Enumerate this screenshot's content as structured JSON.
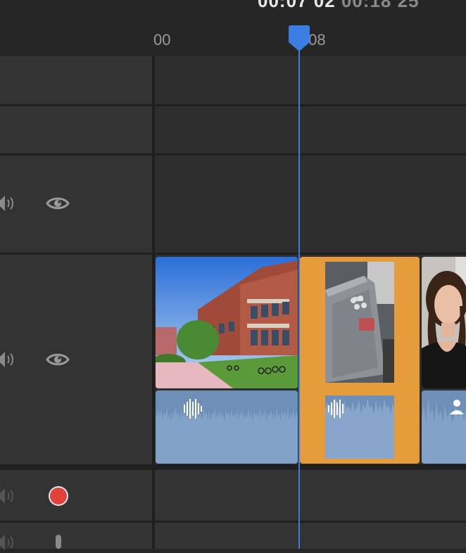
{
  "timecode": {
    "current": "00:07",
    "current_frames": "02",
    "total": "00:18",
    "total_frames": "25"
  },
  "ruler": {
    "label_left": "00",
    "label_right": ":08"
  },
  "tracks": [
    {
      "name": "title-track"
    },
    {
      "name": "overlay-track"
    },
    {
      "name": "video-track-2",
      "speaker": "speaker-icon",
      "eye": "eye-icon"
    },
    {
      "name": "main-video-track",
      "speaker": "speaker-icon",
      "eye": "eye-icon"
    },
    {
      "name": "voiceover-track",
      "speaker": "speaker-icon",
      "record": "record-icon"
    },
    {
      "name": "mic-track",
      "speaker": "speaker-icon",
      "mic": "microphone-icon"
    }
  ],
  "clips": [
    {
      "name": "clip-building",
      "selected": false,
      "color": "#6e8fb8"
    },
    {
      "name": "clip-machine",
      "selected": true,
      "color": "#e59c3b"
    },
    {
      "name": "clip-person",
      "selected": false,
      "color": "#6e8fb8"
    }
  ],
  "colors": {
    "accent": "#3b7de0",
    "selected": "#e59c3b",
    "record": "#e0413a"
  }
}
